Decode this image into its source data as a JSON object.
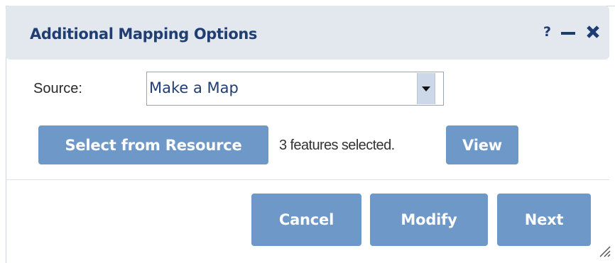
{
  "dialog": {
    "title": "Additional Mapping Options",
    "help_label": "?"
  },
  "source": {
    "label": "Source:",
    "selected": "Make a Map"
  },
  "features": {
    "select_button_label": "Select from Resource",
    "status_text": "3 features selected.",
    "view_button_label": "View"
  },
  "footer": {
    "cancel_label": "Cancel",
    "modify_label": "Modify",
    "next_label": "Next"
  },
  "icons": {
    "help": "help-icon",
    "minimize": "minimize-icon",
    "close": "close-icon",
    "dropdown": "chevron-down-icon",
    "resize": "resize-grip-icon"
  },
  "colors": {
    "titlebar_bg": "#e3e8ee",
    "title_text": "#203e72",
    "button_bg": "#6e98c8",
    "button_text": "#ffffff"
  }
}
